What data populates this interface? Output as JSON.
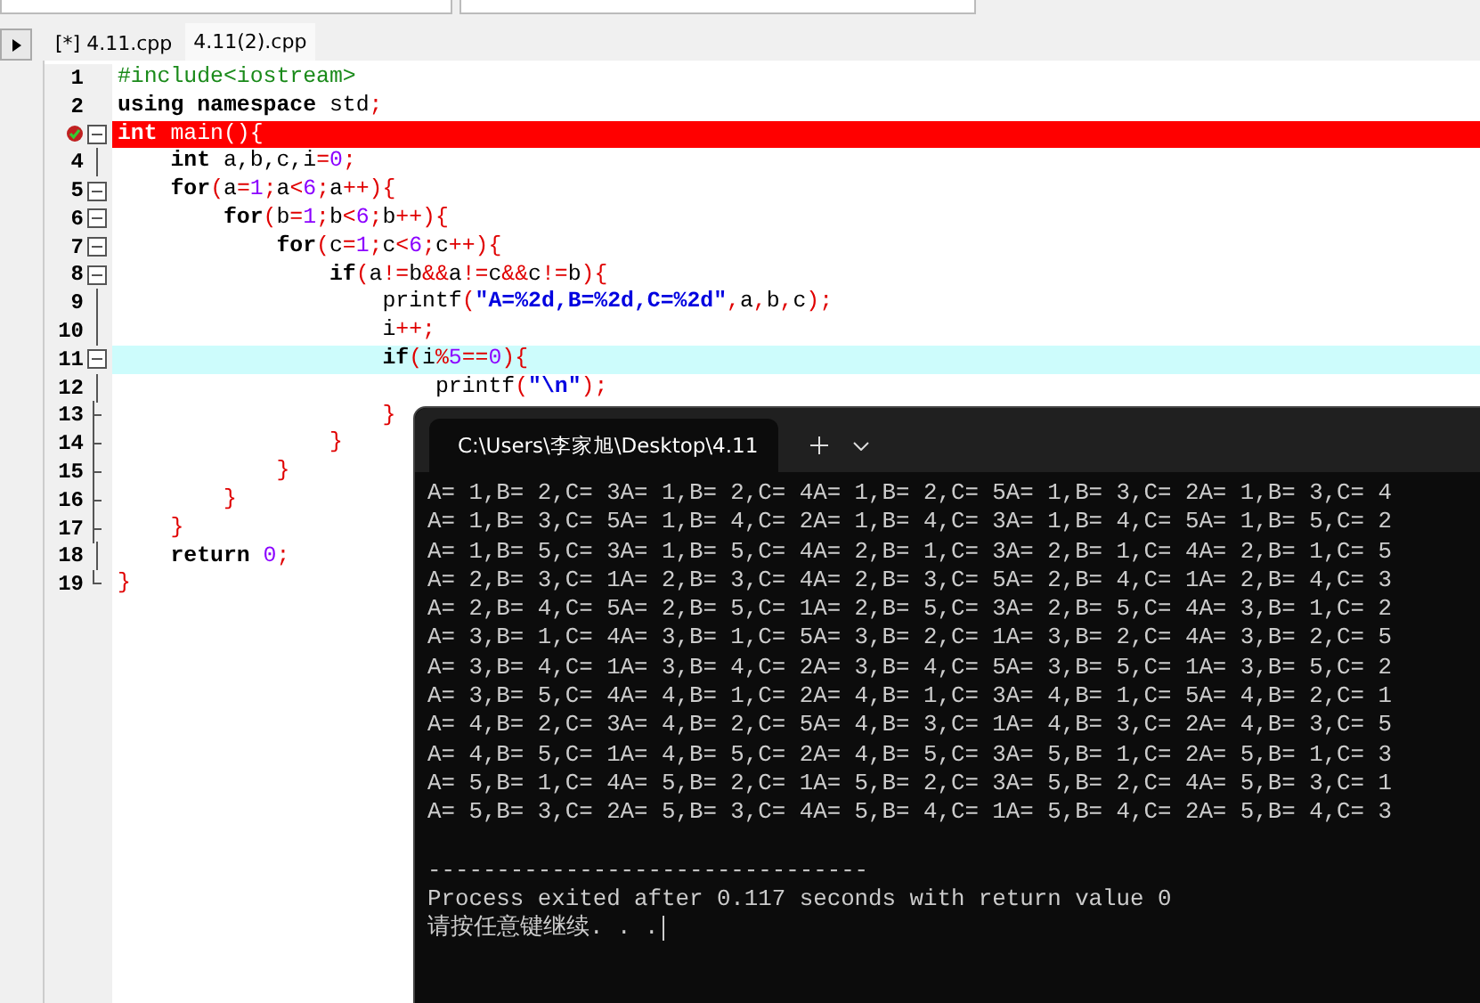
{
  "tabs": [
    {
      "label": "[*] 4.11.cpp",
      "selected": false
    },
    {
      "label": "4.11(2).cpp",
      "selected": true
    }
  ],
  "editor": {
    "lines": [
      {
        "number": "1",
        "kind": "plain",
        "breakpoint": false,
        "current": false,
        "tokens": [
          {
            "kind": "preproc",
            "text": "#include<iostream>"
          }
        ]
      },
      {
        "number": "2",
        "kind": "plain",
        "breakpoint": false,
        "current": false,
        "tokens": [
          {
            "kind": "keyword",
            "text": "using namespace"
          },
          {
            "kind": "plain",
            "text": " std"
          },
          {
            "kind": "symbol",
            "text": ";"
          }
        ]
      },
      {
        "kind": "open",
        "breakpoint": true,
        "current": false,
        "tokens": [
          {
            "kind": "keyword",
            "text": "int"
          },
          {
            "kind": "plain",
            "text": " main"
          },
          {
            "kind": "symbol",
            "text": "(){"
          }
        ]
      },
      {
        "number": "4",
        "kind": "inner",
        "breakpoint": false,
        "current": false,
        "tokens": [
          {
            "kind": "keyword",
            "text": "    int"
          },
          {
            "kind": "plain",
            "text": " a,b,c,i"
          },
          {
            "kind": "symbol",
            "text": "="
          },
          {
            "kind": "number",
            "text": "0"
          },
          {
            "kind": "symbol",
            "text": ";"
          }
        ]
      },
      {
        "number": "5",
        "kind": "open",
        "breakpoint": false,
        "current": false,
        "tokens": [
          {
            "kind": "keyword",
            "text": "    for"
          },
          {
            "kind": "symbol",
            "text": "("
          },
          {
            "kind": "plain",
            "text": "a"
          },
          {
            "kind": "symbol",
            "text": "="
          },
          {
            "kind": "number",
            "text": "1"
          },
          {
            "kind": "symbol",
            "text": ";"
          },
          {
            "kind": "plain",
            "text": "a"
          },
          {
            "kind": "symbol",
            "text": "<"
          },
          {
            "kind": "number",
            "text": "6"
          },
          {
            "kind": "symbol",
            "text": ";"
          },
          {
            "kind": "plain",
            "text": "a"
          },
          {
            "kind": "symbol",
            "text": "++){"
          }
        ]
      },
      {
        "number": "6",
        "kind": "open",
        "breakpoint": false,
        "current": false,
        "tokens": [
          {
            "kind": "keyword",
            "text": "        for"
          },
          {
            "kind": "symbol",
            "text": "("
          },
          {
            "kind": "plain",
            "text": "b"
          },
          {
            "kind": "symbol",
            "text": "="
          },
          {
            "kind": "number",
            "text": "1"
          },
          {
            "kind": "symbol",
            "text": ";"
          },
          {
            "kind": "plain",
            "text": "b"
          },
          {
            "kind": "symbol",
            "text": "<"
          },
          {
            "kind": "number",
            "text": "6"
          },
          {
            "kind": "symbol",
            "text": ";"
          },
          {
            "kind": "plain",
            "text": "b"
          },
          {
            "kind": "symbol",
            "text": "++){"
          }
        ]
      },
      {
        "number": "7",
        "kind": "open",
        "breakpoint": false,
        "current": false,
        "tokens": [
          {
            "kind": "keyword",
            "text": "            for"
          },
          {
            "kind": "symbol",
            "text": "("
          },
          {
            "kind": "plain",
            "text": "c"
          },
          {
            "kind": "symbol",
            "text": "="
          },
          {
            "kind": "number",
            "text": "1"
          },
          {
            "kind": "symbol",
            "text": ";"
          },
          {
            "kind": "plain",
            "text": "c"
          },
          {
            "kind": "symbol",
            "text": "<"
          },
          {
            "kind": "number",
            "text": "6"
          },
          {
            "kind": "symbol",
            "text": ";"
          },
          {
            "kind": "plain",
            "text": "c"
          },
          {
            "kind": "symbol",
            "text": "++){"
          }
        ]
      },
      {
        "number": "8",
        "kind": "open",
        "breakpoint": false,
        "current": false,
        "tokens": [
          {
            "kind": "keyword",
            "text": "                if"
          },
          {
            "kind": "symbol",
            "text": "("
          },
          {
            "kind": "plain",
            "text": "a"
          },
          {
            "kind": "symbol",
            "text": "!="
          },
          {
            "kind": "plain",
            "text": "b"
          },
          {
            "kind": "symbol",
            "text": "&&"
          },
          {
            "kind": "plain",
            "text": "a"
          },
          {
            "kind": "symbol",
            "text": "!="
          },
          {
            "kind": "plain",
            "text": "c"
          },
          {
            "kind": "symbol",
            "text": "&&"
          },
          {
            "kind": "plain",
            "text": "c"
          },
          {
            "kind": "symbol",
            "text": "!="
          },
          {
            "kind": "plain",
            "text": "b"
          },
          {
            "kind": "symbol",
            "text": "){"
          }
        ]
      },
      {
        "number": "9",
        "kind": "inner",
        "breakpoint": false,
        "current": false,
        "tokens": [
          {
            "kind": "plain",
            "text": "                    printf"
          },
          {
            "kind": "symbol",
            "text": "("
          },
          {
            "kind": "string",
            "text": "\"A=%2d,B=%2d,C=%2d\""
          },
          {
            "kind": "symbol",
            "text": ","
          },
          {
            "kind": "plain",
            "text": "a"
          },
          {
            "kind": "symbol",
            "text": ","
          },
          {
            "kind": "plain",
            "text": "b"
          },
          {
            "kind": "symbol",
            "text": ","
          },
          {
            "kind": "plain",
            "text": "c"
          },
          {
            "kind": "symbol",
            "text": ");"
          }
        ]
      },
      {
        "number": "10",
        "kind": "inner",
        "breakpoint": false,
        "current": false,
        "tokens": [
          {
            "kind": "plain",
            "text": "                    i"
          },
          {
            "kind": "symbol",
            "text": "++;"
          }
        ]
      },
      {
        "number": "11",
        "kind": "open",
        "breakpoint": false,
        "current": true,
        "tokens": [
          {
            "kind": "keyword",
            "text": "                    if"
          },
          {
            "kind": "symbol",
            "text": "("
          },
          {
            "kind": "plain",
            "text": "i"
          },
          {
            "kind": "symbol",
            "text": "%"
          },
          {
            "kind": "number",
            "text": "5"
          },
          {
            "kind": "symbol",
            "text": "=="
          },
          {
            "kind": "number",
            "text": "0"
          },
          {
            "kind": "symbol",
            "text": "){"
          }
        ]
      },
      {
        "number": "12",
        "kind": "inner",
        "breakpoint": false,
        "current": false,
        "tokens": [
          {
            "kind": "plain",
            "text": "                        printf"
          },
          {
            "kind": "symbol",
            "text": "("
          },
          {
            "kind": "string",
            "text": "\"\\n\""
          },
          {
            "kind": "symbol",
            "text": ");"
          }
        ]
      },
      {
        "number": "13",
        "kind": "close",
        "breakpoint": false,
        "current": false,
        "tokens": [
          {
            "kind": "symbol",
            "text": "                    }"
          }
        ]
      },
      {
        "number": "14",
        "kind": "close",
        "breakpoint": false,
        "current": false,
        "tokens": [
          {
            "kind": "symbol",
            "text": "                }"
          }
        ]
      },
      {
        "number": "15",
        "kind": "close",
        "breakpoint": false,
        "current": false,
        "tokens": [
          {
            "kind": "symbol",
            "text": "            }"
          }
        ]
      },
      {
        "number": "16",
        "kind": "close",
        "breakpoint": false,
        "current": false,
        "tokens": [
          {
            "kind": "symbol",
            "text": "        }"
          }
        ]
      },
      {
        "number": "17",
        "kind": "close",
        "breakpoint": false,
        "current": false,
        "tokens": [
          {
            "kind": "symbol",
            "text": "    }"
          }
        ]
      },
      {
        "number": "18",
        "kind": "inner",
        "breakpoint": false,
        "current": false,
        "tokens": [
          {
            "kind": "keyword",
            "text": "    return"
          },
          {
            "kind": "number",
            "text": " 0"
          },
          {
            "kind": "symbol",
            "text": ";"
          }
        ]
      },
      {
        "number": "19",
        "kind": "last",
        "breakpoint": false,
        "current": false,
        "tokens": [
          {
            "kind": "symbol",
            "text": "}"
          }
        ]
      }
    ]
  },
  "terminal": {
    "tab_title": "C:\\Users\\李家旭\\Desktop\\4.11",
    "output": [
      "A= 1,B= 2,C= 3A= 1,B= 2,C= 4A= 1,B= 2,C= 5A= 1,B= 3,C= 2A= 1,B= 3,C= 4",
      "A= 1,B= 3,C= 5A= 1,B= 4,C= 2A= 1,B= 4,C= 3A= 1,B= 4,C= 5A= 1,B= 5,C= 2",
      "A= 1,B= 5,C= 3A= 1,B= 5,C= 4A= 2,B= 1,C= 3A= 2,B= 1,C= 4A= 2,B= 1,C= 5",
      "A= 2,B= 3,C= 1A= 2,B= 3,C= 4A= 2,B= 3,C= 5A= 2,B= 4,C= 1A= 2,B= 4,C= 3",
      "A= 2,B= 4,C= 5A= 2,B= 5,C= 1A= 2,B= 5,C= 3A= 2,B= 5,C= 4A= 3,B= 1,C= 2",
      "A= 3,B= 1,C= 4A= 3,B= 1,C= 5A= 3,B= 2,C= 1A= 3,B= 2,C= 4A= 3,B= 2,C= 5",
      "A= 3,B= 4,C= 1A= 3,B= 4,C= 2A= 3,B= 4,C= 5A= 3,B= 5,C= 1A= 3,B= 5,C= 2",
      "A= 3,B= 5,C= 4A= 4,B= 1,C= 2A= 4,B= 1,C= 3A= 4,B= 1,C= 5A= 4,B= 2,C= 1",
      "A= 4,B= 2,C= 3A= 4,B= 2,C= 5A= 4,B= 3,C= 1A= 4,B= 3,C= 2A= 4,B= 3,C= 5",
      "A= 4,B= 5,C= 1A= 4,B= 5,C= 2A= 4,B= 5,C= 3A= 5,B= 1,C= 2A= 5,B= 1,C= 3",
      "A= 5,B= 1,C= 4A= 5,B= 2,C= 1A= 5,B= 2,C= 3A= 5,B= 2,C= 4A= 5,B= 3,C= 1",
      "A= 5,B= 3,C= 2A= 5,B= 3,C= 4A= 5,B= 4,C= 1A= 5,B= 4,C= 2A= 5,B= 4,C= 3"
    ],
    "separator": "--------------------------------",
    "exit_message": "Process exited after 0.117 seconds with return value 0",
    "prompt": "请按任意键继续. . ."
  }
}
